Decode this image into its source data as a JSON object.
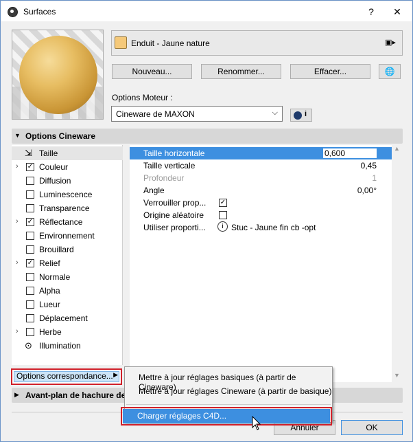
{
  "window": {
    "title": "Surfaces",
    "help_label": "?",
    "close_label": "✕"
  },
  "material": {
    "name": "Enduit - Jaune nature",
    "color": "#f5c97a"
  },
  "buttons": {
    "new": "Nouveau...",
    "rename": "Renommer...",
    "delete": "Effacer...",
    "ok": "OK",
    "cancel": "Annuler"
  },
  "engine": {
    "label": "Options Moteur :",
    "selected": "Cineware de MAXON",
    "info_label": "i"
  },
  "sections": {
    "cineware": "Options Cineware",
    "hatch": "Avant-plan de hachure de r"
  },
  "channels": [
    {
      "label": "Taille",
      "checked": null,
      "expandable": false,
      "selected": true
    },
    {
      "label": "Couleur",
      "checked": true,
      "expandable": true
    },
    {
      "label": "Diffusion",
      "checked": false,
      "expandable": false
    },
    {
      "label": "Luminescence",
      "checked": false,
      "expandable": false
    },
    {
      "label": "Transparence",
      "checked": false,
      "expandable": false
    },
    {
      "label": "Réflectance",
      "checked": true,
      "expandable": true
    },
    {
      "label": "Environnement",
      "checked": false,
      "expandable": false
    },
    {
      "label": "Brouillard",
      "checked": false,
      "expandable": false
    },
    {
      "label": "Relief",
      "checked": true,
      "expandable": true
    },
    {
      "label": "Normale",
      "checked": false,
      "expandable": false
    },
    {
      "label": "Alpha",
      "checked": false,
      "expandable": false
    },
    {
      "label": "Lueur",
      "checked": false,
      "expandable": false
    },
    {
      "label": "Déplacement",
      "checked": false,
      "expandable": false
    },
    {
      "label": "Herbe",
      "checked": false,
      "expandable": true
    },
    {
      "label": "Illumination",
      "checked": null,
      "expandable": false
    }
  ],
  "properties": [
    {
      "label": "Taille horizontale",
      "value": "0,600"
    },
    {
      "label": "Taille verticale",
      "value": "0,45"
    },
    {
      "label": "Profondeur",
      "value": "1"
    },
    {
      "label": "Angle",
      "value": "0,00°"
    },
    {
      "label": "Verrouiller prop...",
      "value": ""
    },
    {
      "label": "Origine aléatoire",
      "value": ""
    },
    {
      "label": "Utiliser proporti...",
      "value": "Stuc - Jaune fin cb -opt"
    }
  ],
  "mapping_button": "Options correspondance...",
  "context_menu": {
    "items": [
      "Mettre à jour réglages basiques (à partir de Cineware)",
      "Mettre à jour réglages Cineware (à partir de basique)"
    ],
    "highlighted": "Charger réglages C4D..."
  }
}
